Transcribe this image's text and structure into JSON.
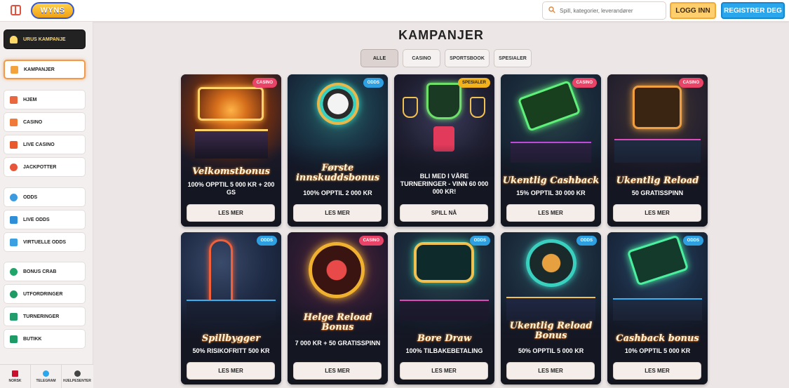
{
  "header": {
    "logo_text": "WYNS",
    "search_placeholder": "Spill, kategorier, leverandører",
    "login_label": "LOGG INN",
    "register_label": "REGISTRER DEG"
  },
  "sidebar": {
    "items": [
      {
        "label": "URUS KAMPANJE",
        "icon": "crown-icon"
      },
      {
        "label": "KAMPANJER",
        "icon": "gift-icon"
      },
      {
        "label": "HJEM",
        "icon": "home-icon"
      },
      {
        "label": "CASINO",
        "icon": "slot-icon"
      },
      {
        "label": "LIVE CASINO",
        "icon": "card-icon"
      },
      {
        "label": "JACKPOTTER",
        "icon": "puzzle-icon"
      },
      {
        "label": "ODDS",
        "icon": "ball-icon"
      },
      {
        "label": "LIVE ODDS",
        "icon": "live-icon"
      },
      {
        "label": "VIRTUELLE ODDS",
        "icon": "monitor-icon"
      },
      {
        "label": "BONUS CRAB",
        "icon": "crab-icon"
      },
      {
        "label": "UTFORDRINGER",
        "icon": "medal-icon"
      },
      {
        "label": "TURNERINGER",
        "icon": "podium-icon"
      },
      {
        "label": "BUTIKK",
        "icon": "basket-icon"
      }
    ],
    "footer": [
      {
        "label": "NORSK",
        "icon": "flag-icon"
      },
      {
        "label": "TELEGRAM",
        "icon": "telegram-icon"
      },
      {
        "label": "HJELPESENTER",
        "icon": "help-icon"
      }
    ]
  },
  "main": {
    "title": "KAMPANJER",
    "filters": [
      "ALLE",
      "CASINO",
      "SPORTSBOOK",
      "SPESIALER"
    ],
    "active_filter": "ALLE",
    "cards": [
      {
        "badge": "CASINO",
        "script_title": "Velkomstbonus",
        "subtitle": "100% OPPTIL 5 000 KR + 200 GS",
        "button": "LES MER"
      },
      {
        "badge": "ODDS",
        "script_title": "Første innskuddsbonus",
        "subtitle": "100% OPPTIL 2 000 KR",
        "button": "LES MER"
      },
      {
        "badge": "SPESIALER",
        "script_title": "",
        "subtitle": "BLI MED I VÅRE TURNERINGER - VINN 60 000 000 KR!",
        "button": "SPILL NÅ"
      },
      {
        "badge": "CASINO",
        "script_title": "Ukentlig Cashback",
        "subtitle": "15% OPPTIL 30 000 KR",
        "button": "LES MER"
      },
      {
        "badge": "CASINO",
        "script_title": "Ukentlig Reload",
        "subtitle": "50 GRATISSPINN",
        "button": "LES MER"
      },
      {
        "badge": "ODDS",
        "script_title": "Spillbygger",
        "subtitle": "50% RISIKOFRITT 500 KR",
        "button": "LES MER"
      },
      {
        "badge": "CASINO",
        "script_title": "Helge Reload Bonus",
        "subtitle": "7 000 KR + 50 GRATISSPINN",
        "button": "LES MER"
      },
      {
        "badge": "ODDS",
        "script_title": "Bore Draw",
        "subtitle": "100% TILBAKEBETALING",
        "button": "LES MER"
      },
      {
        "badge": "ODDS",
        "script_title": "Ukentlig Reload Bonus",
        "subtitle": "50% OPPTIL 5 000 KR",
        "button": "LES MER"
      },
      {
        "badge": "ODDS",
        "script_title": "Cashback bonus",
        "subtitle": "10% OPPTIL 5 000 KR",
        "button": "LES MER"
      }
    ]
  },
  "colors": {
    "accent_orange": "#f29a4a",
    "login_yellow": "#ffcf6e",
    "register_blue": "#2aa6ec",
    "badge_casino": "#e94467",
    "badge_odds": "#2e9fe0",
    "badge_spesialer": "#f2b21c"
  }
}
